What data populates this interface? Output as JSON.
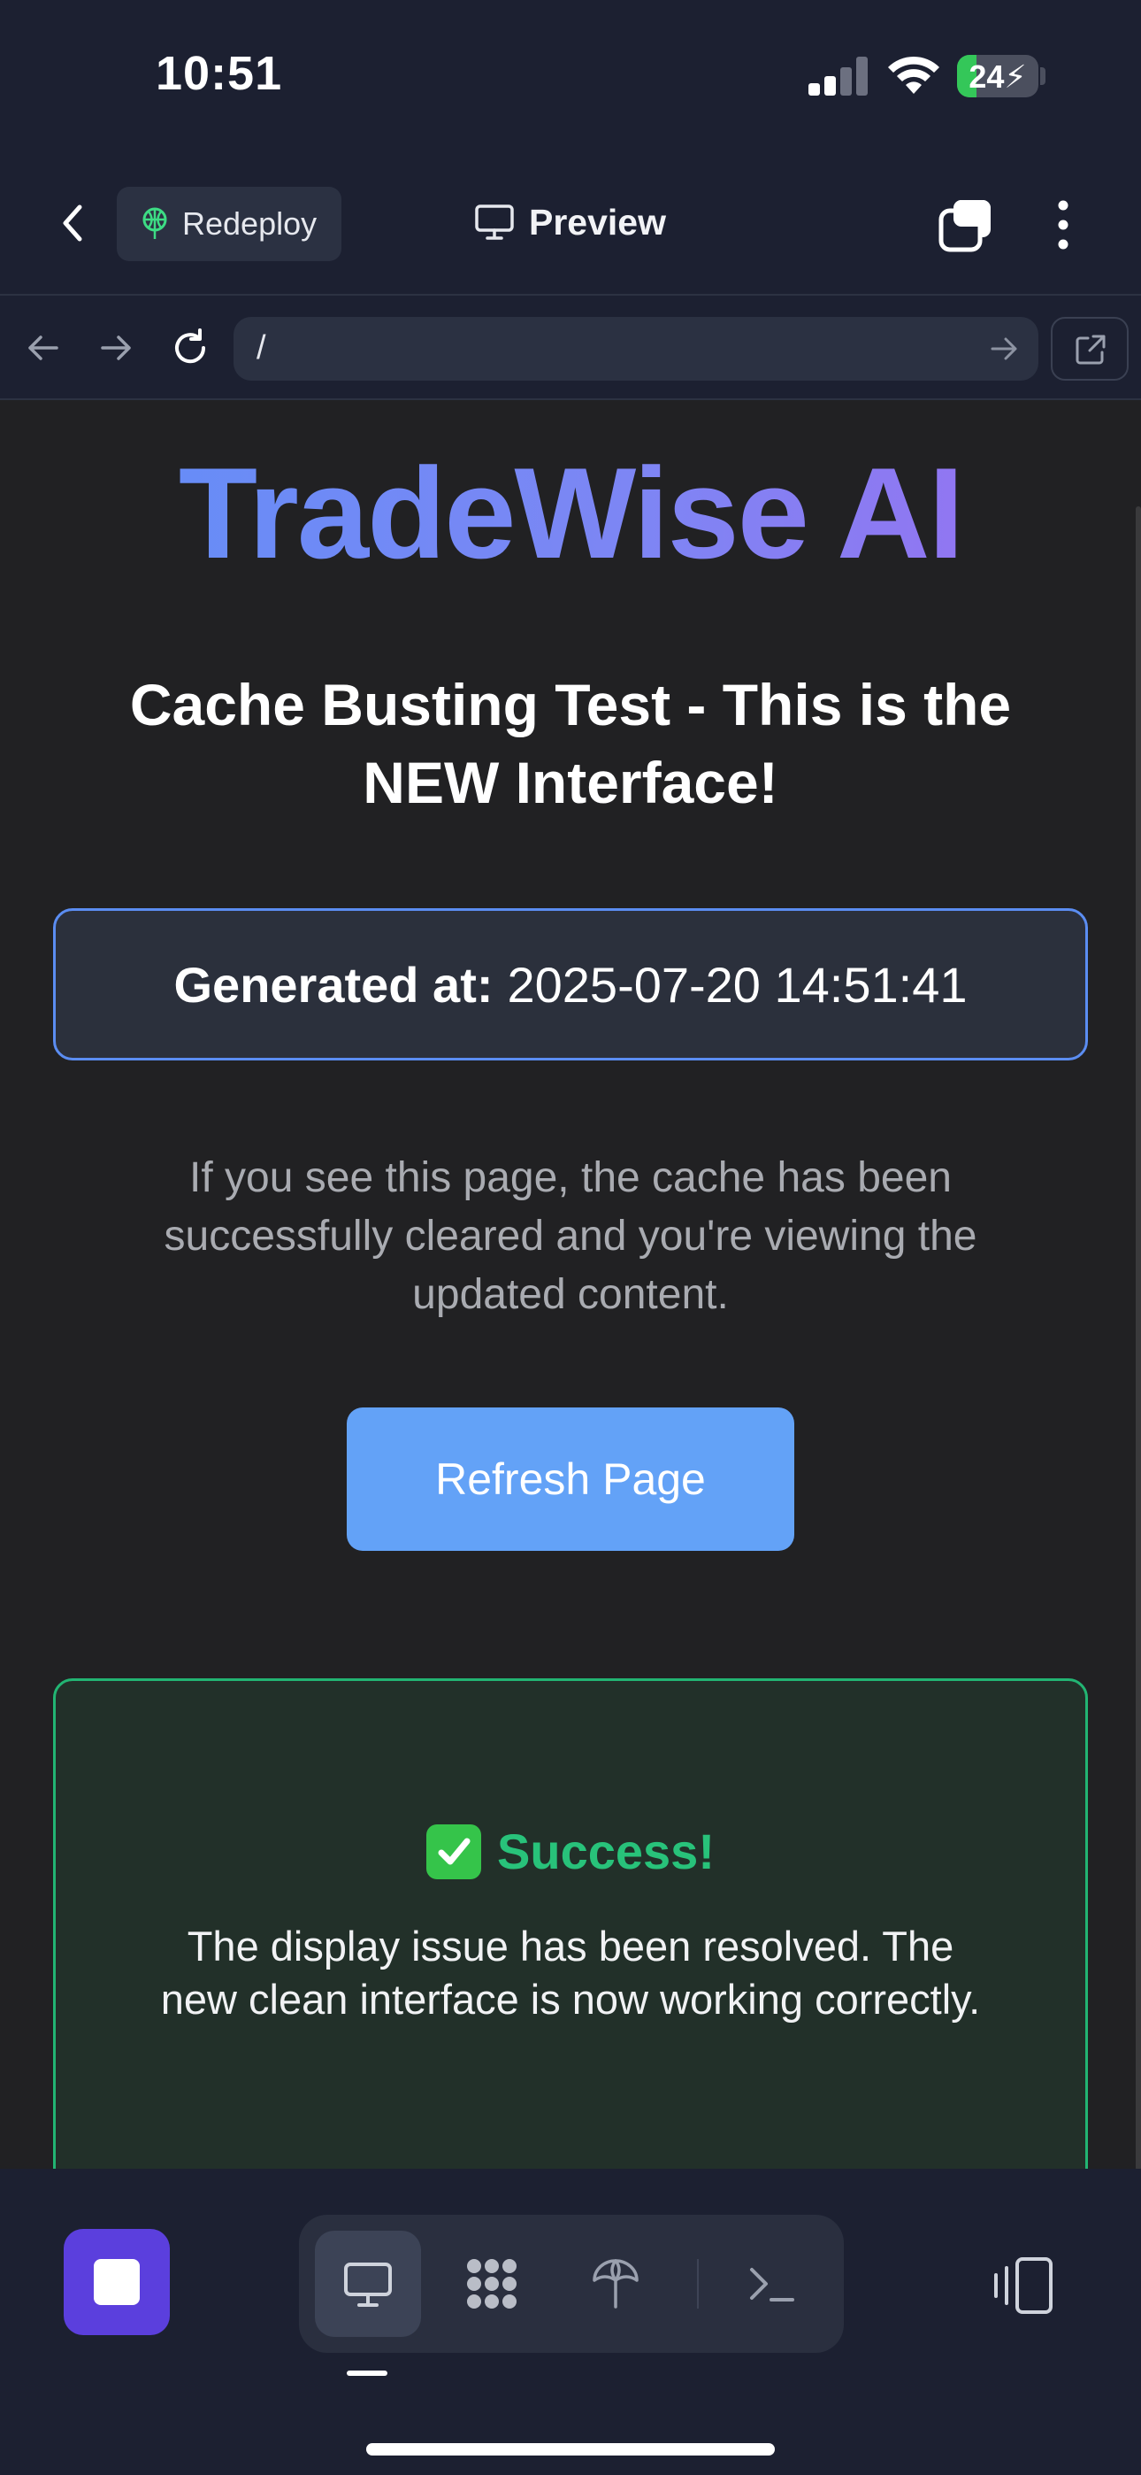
{
  "status_bar": {
    "time": "10:51",
    "battery": "24",
    "battery_level": 0.24
  },
  "header": {
    "redeploy_label": "Redeploy",
    "title": "Preview"
  },
  "browser": {
    "url": "/"
  },
  "page": {
    "brand": "TradeWise AI",
    "heading": "Cache Busting Test - This is the NEW Interface!",
    "generated_label": "Generated at:",
    "generated_value": "2025-07-20 14:51:41",
    "info": "If you see this page, the cache has been successfully cleared and you're viewing the updated content.",
    "refresh_button": "Refresh Page",
    "success_title": "Success!",
    "success_message": "The display issue has been resolved. The new clean interface is now working correctly."
  },
  "dock": {
    "items": [
      "desktop-icon",
      "apps-icon",
      "deploy-icon",
      "terminal-icon"
    ],
    "active": "desktop-icon"
  },
  "colors": {
    "accent": "#5b3fdd",
    "link_blue": "#63a2f7",
    "success": "#28c27a"
  }
}
